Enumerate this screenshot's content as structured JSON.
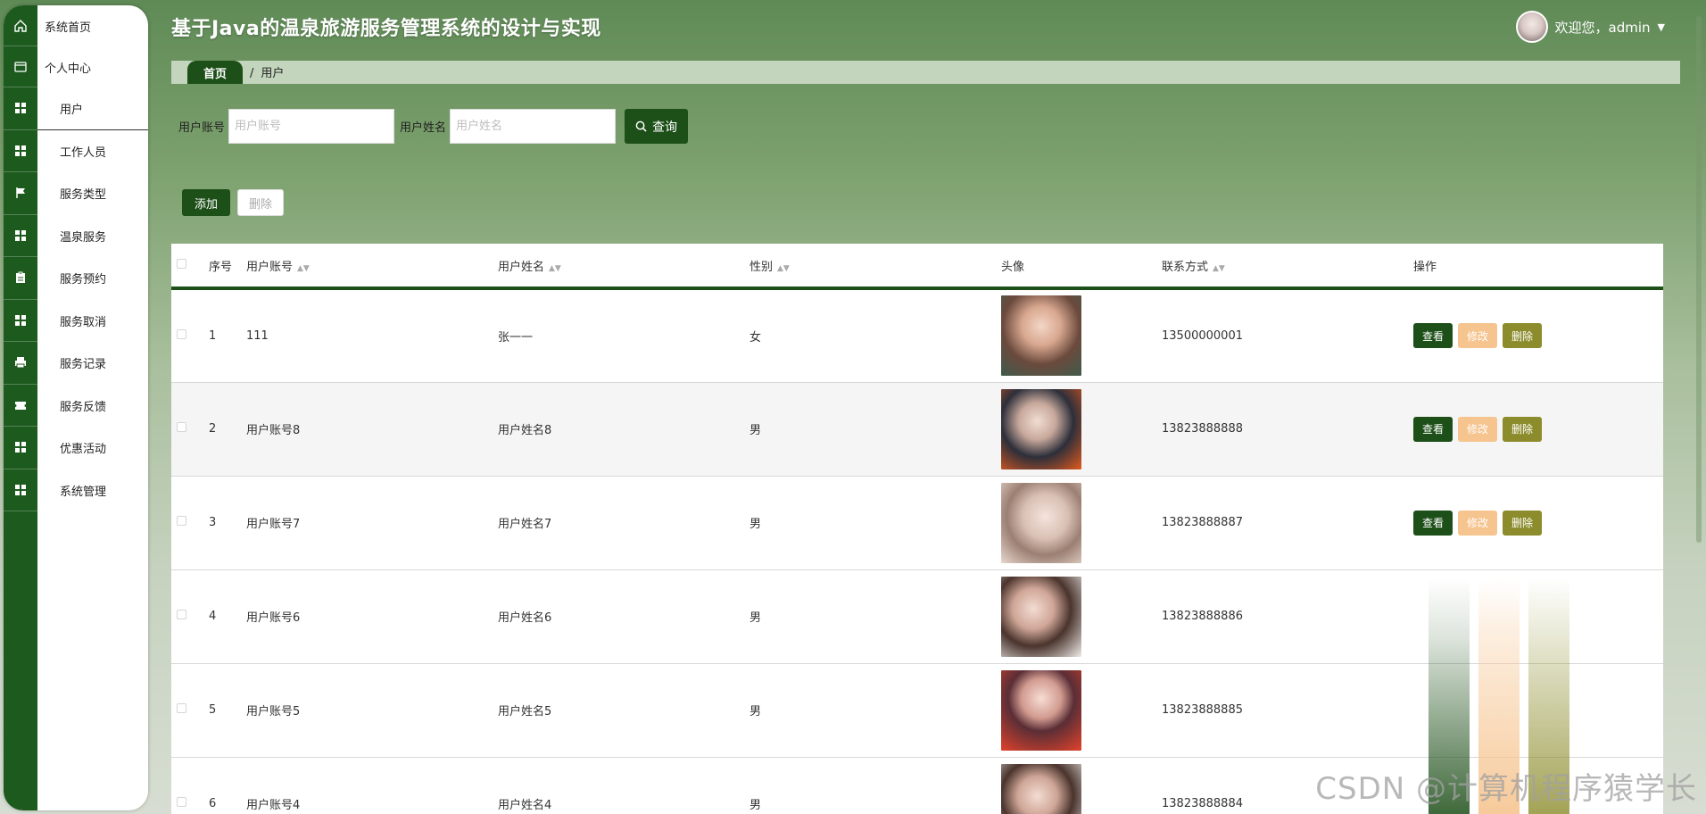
{
  "app_title": "基于Java的温泉旅游服务管理系统的设计与实现",
  "user": {
    "greeting": "欢迎您，admin"
  },
  "breadcrumb": {
    "home": "首页",
    "separator": "/",
    "current": "用户"
  },
  "sidebar": {
    "items": [
      {
        "label": "系统首页",
        "icon": "home-icon"
      },
      {
        "label": "个人中心",
        "icon": "wallet-icon"
      },
      {
        "label": "用户",
        "icon": "grid-icon"
      },
      {
        "label": "工作人员",
        "icon": "grid-icon"
      },
      {
        "label": "服务类型",
        "icon": "flag-icon"
      },
      {
        "label": "温泉服务",
        "icon": "grid-icon"
      },
      {
        "label": "服务预约",
        "icon": "clipboard-icon"
      },
      {
        "label": "服务取消",
        "icon": "grid-icon"
      },
      {
        "label": "服务记录",
        "icon": "printer-icon"
      },
      {
        "label": "服务反馈",
        "icon": "ticket-icon"
      },
      {
        "label": "优惠活动",
        "icon": "grid-icon"
      },
      {
        "label": "系统管理",
        "icon": "grid-icon"
      }
    ]
  },
  "search": {
    "account_label": "用户账号",
    "account_placeholder": "用户账号",
    "name_label": "用户姓名",
    "name_placeholder": "用户姓名",
    "button": "查询"
  },
  "actions": {
    "add": "添加",
    "delete": "删除"
  },
  "table": {
    "headers": {
      "index": "序号",
      "account": "用户账号",
      "name": "用户姓名",
      "gender": "性别",
      "avatar": "头像",
      "phone": "联系方式",
      "ops": "操作"
    },
    "op_labels": {
      "view": "查看",
      "edit": "修改",
      "delete": "删除"
    },
    "rows": [
      {
        "index": "1",
        "account": "111",
        "name": "张一一",
        "gender": "女",
        "phone": "13500000001"
      },
      {
        "index": "2",
        "account": "用户账号8",
        "name": "用户姓名8",
        "gender": "男",
        "phone": "13823888888"
      },
      {
        "index": "3",
        "account": "用户账号7",
        "name": "用户姓名7",
        "gender": "男",
        "phone": "13823888887"
      },
      {
        "index": "4",
        "account": "用户账号6",
        "name": "用户姓名6",
        "gender": "男",
        "phone": "13823888886"
      },
      {
        "index": "5",
        "account": "用户账号5",
        "name": "用户姓名5",
        "gender": "男",
        "phone": "13823888885"
      },
      {
        "index": "6",
        "account": "用户账号4",
        "name": "用户姓名4",
        "gender": "男",
        "phone": "13823888884"
      }
    ]
  },
  "watermark": "CSDN @计算机程序猿学长",
  "colors": {
    "primary": "#1d4f18",
    "edit": "#f6c48f",
    "delete": "#8c8c2c"
  }
}
